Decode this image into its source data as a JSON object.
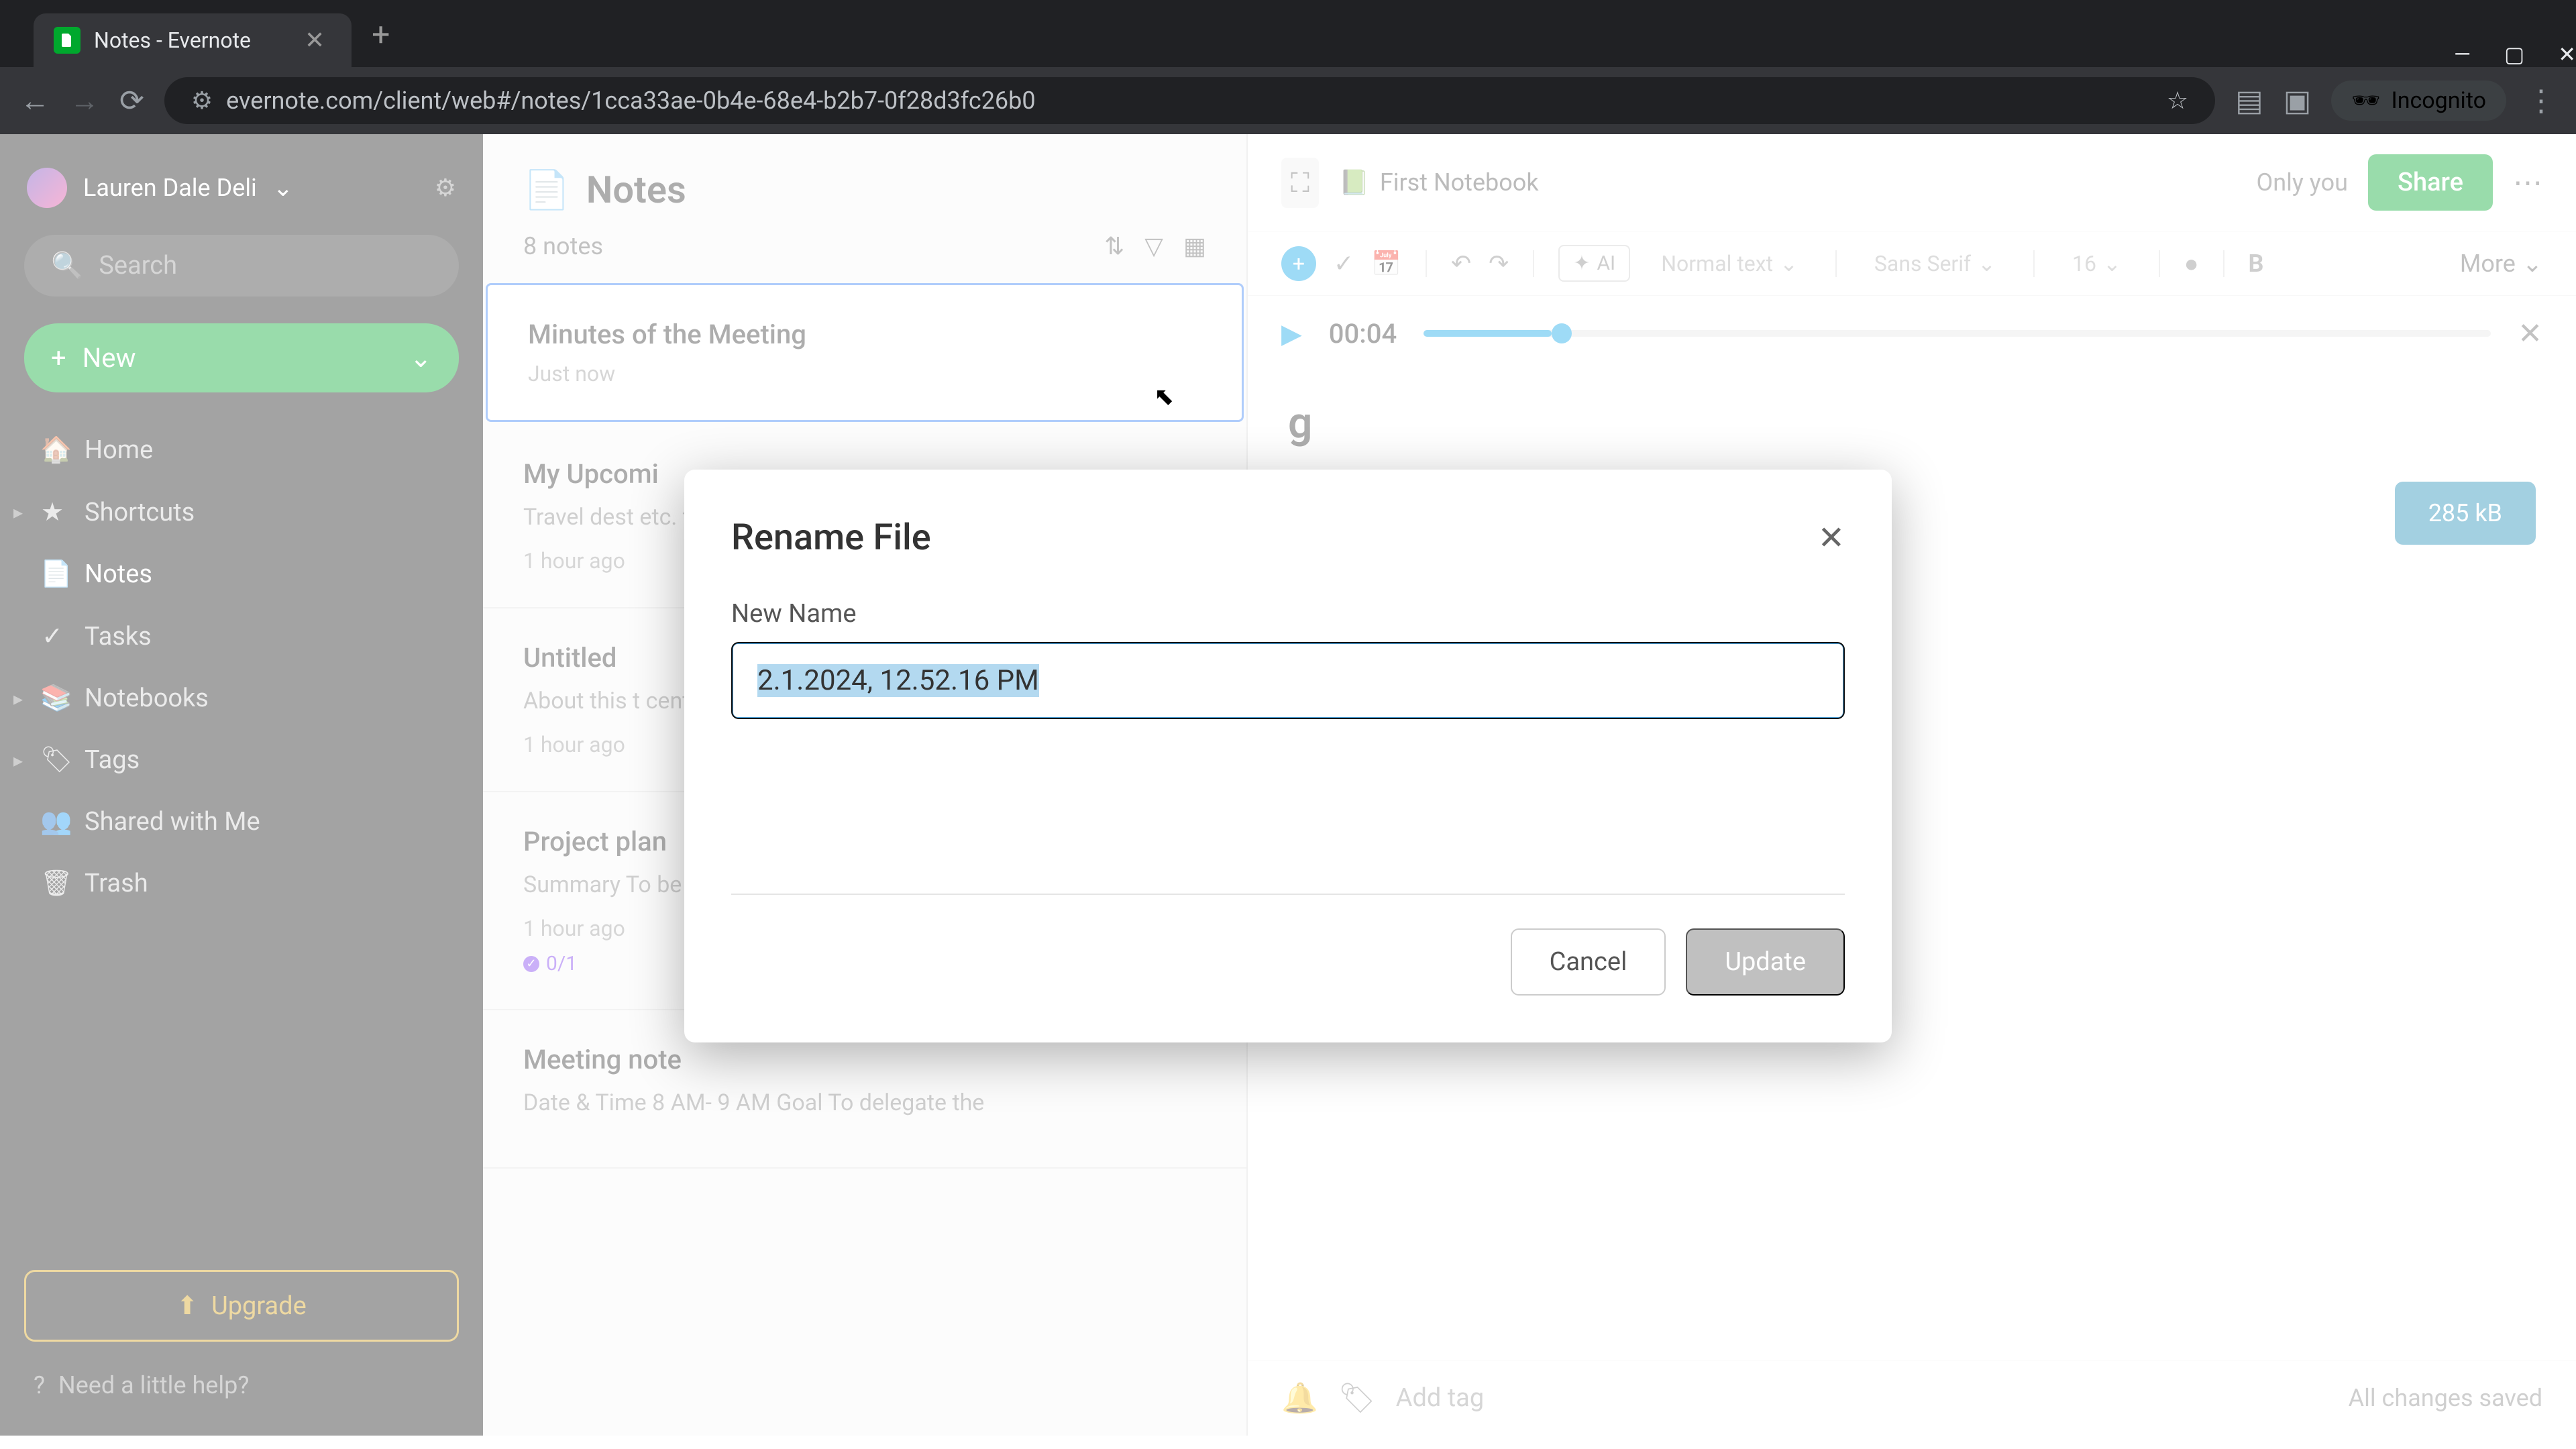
{
  "browser": {
    "tab_title": "Notes - Evernote",
    "url": "evernote.com/client/web#/notes/1cca33ae-0b4e-68e4-b2b7-0f28d3fc26b0",
    "incognito_label": "Incognito"
  },
  "sidebar": {
    "user_name": "Lauren Dale Deli",
    "search_placeholder": "Search",
    "new_button": "New",
    "items": [
      {
        "icon": "home-icon",
        "label": "Home"
      },
      {
        "icon": "star-icon",
        "label": "Shortcuts",
        "expandable": true
      },
      {
        "icon": "note-icon",
        "label": "Notes",
        "active": true
      },
      {
        "icon": "check-icon",
        "label": "Tasks"
      },
      {
        "icon": "book-icon",
        "label": "Notebooks",
        "expandable": true
      },
      {
        "icon": "tag-icon",
        "label": "Tags",
        "expandable": true
      },
      {
        "icon": "share-icon",
        "label": "Shared with Me"
      },
      {
        "icon": "trash-icon",
        "label": "Trash"
      }
    ],
    "upgrade_label": "Upgrade",
    "help_label": "Need a little help?"
  },
  "notes_panel": {
    "title": "Notes",
    "count": "8 notes",
    "items": [
      {
        "title": "Minutes of the Meeting",
        "preview": "",
        "time": "Just now",
        "selected": true
      },
      {
        "title": "My Upcomi",
        "preview": "Travel dest etc. travel o",
        "time": "1 hour ago"
      },
      {
        "title": "Untitled",
        "preview": "About this t central repo",
        "time": "1 hour ago"
      },
      {
        "title": "Project plan",
        "preview": "Summary To be able to etc. Major Milestones …",
        "time": "1 hour ago",
        "badge": "0/1"
      },
      {
        "title": "Meeting note",
        "preview": "Date & Time 8 AM- 9 AM Goal To delegate the",
        "time": ""
      }
    ]
  },
  "editor": {
    "notebook": "First Notebook",
    "visibility": "Only you",
    "share_label": "Share",
    "toolbar": {
      "ai_label": "AI",
      "style_label": "Normal text",
      "font_label": "Sans Serif",
      "size_label": "16",
      "more_label": "More"
    },
    "audio": {
      "time": "00:04",
      "progress_pct": 12
    },
    "note_title_visible": "g",
    "file_pill": {
      "size": "285 kB"
    },
    "footer": {
      "add_tag": "Add tag",
      "status": "All changes saved"
    }
  },
  "modal": {
    "title": "Rename File",
    "field_label": "New Name",
    "field_value": "2.1.2024, 12.52.16 PM",
    "cancel_label": "Cancel",
    "update_label": "Update"
  }
}
